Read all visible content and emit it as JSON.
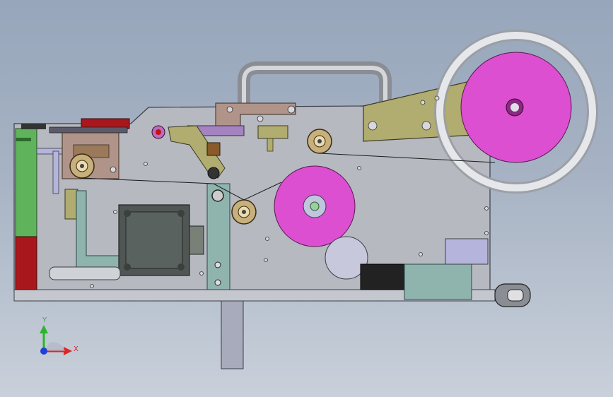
{
  "viewport": {
    "background_top": "#97a6bb",
    "background_bottom": "#c9d0da"
  },
  "colors": {
    "plate": "#b6b9c0",
    "plate_stroke": "#3a3f48",
    "reel_magenta": "#dc4fd0",
    "bracket_olive": "#b1ac6f",
    "bracket_tan": "#b0948a",
    "green_panel": "#5fb35a",
    "red_panel": "#a8171c",
    "teal_bracket": "#8fb3ad",
    "motor_dark": "#4f5654",
    "roller_gold": "#c7b07c",
    "lavender": "#b4b4dc",
    "purple_slide": "#a483c0"
  },
  "triad": {
    "y_label": "Y",
    "x_label": "X",
    "y_color": "#2bb52b",
    "x_color": "#e02525",
    "z_color": "#2040d8"
  }
}
